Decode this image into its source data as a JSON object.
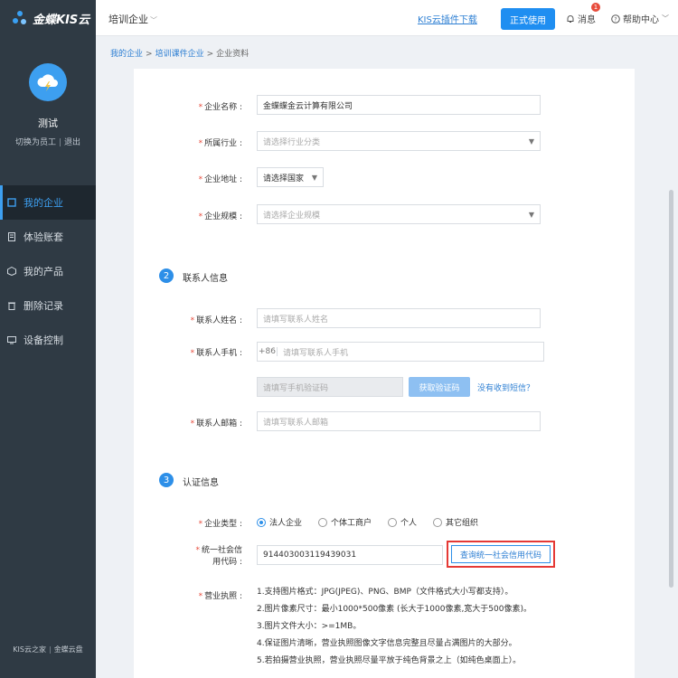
{
  "sidebar": {
    "logo_text": "金蝶KIS云",
    "user_name": "测试",
    "switch_label": "切换为员工",
    "logout_label": "退出",
    "items": [
      {
        "label": "我的企业",
        "icon": "home-icon",
        "active": true
      },
      {
        "label": "体验账套",
        "icon": "ledger-icon"
      },
      {
        "label": "我的产品",
        "icon": "product-icon"
      },
      {
        "label": "删除记录",
        "icon": "trash-icon"
      },
      {
        "label": "设备控制",
        "icon": "device-icon"
      }
    ],
    "footer_left": "KIS云之家",
    "footer_right": "金蝶云盘"
  },
  "topbar": {
    "org_name": "培训企业",
    "plugin_link": "KIS云插件下载",
    "formal_button": "正式使用",
    "messages_label": "消息",
    "messages_count": "1",
    "help_label": "帮助中心"
  },
  "breadcrumb": {
    "item1": "我的企业",
    "item2": "培训课件企业",
    "item3": "企业资料"
  },
  "company": {
    "name_label": "企业名称 :",
    "name_value": "金蝶蝶金云计算有限公司",
    "industry_label": "所属行业 :",
    "industry_placeholder": "请选择行业分类",
    "address_label": "企业地址 :",
    "address_placeholder": "请选择国家",
    "scale_label": "企业规模 :",
    "scale_placeholder": "请选择企业规模"
  },
  "contact": {
    "step": "2",
    "title": "联系人信息",
    "name_label": "联系人姓名 :",
    "name_placeholder": "请填写联系人姓名",
    "phone_label": "联系人手机 :",
    "phone_prefix": "+86",
    "phone_placeholder": "请填写联系人手机",
    "code_placeholder": "请填写手机验证码",
    "get_code_button": "获取验证码",
    "no_sms_link": "没有收到短信？",
    "email_label": "联系人邮箱 :",
    "email_placeholder": "请填写联系人邮箱"
  },
  "certification": {
    "step": "3",
    "title": "认证信息",
    "type_label": "企业类型 :",
    "type_options": [
      "法人企业",
      "个体工商户",
      "个人",
      "其它组织"
    ],
    "type_selected": 0,
    "credit_label_line1": "统一社会信",
    "credit_label_line2": "用代码 :",
    "credit_value": "914403003119439031",
    "query_button": "查询统一社会信用代码",
    "license_label": "营业执照 :",
    "license_rules": [
      "1.支持图片格式：JPG(JPEG)、PNG、BMP（文件格式大小写都支持）。",
      "2.图片像素尺寸：最小1000*500像素 (长大于1000像素,宽大于500像素)。",
      "3.图片文件大小：>=1MB。",
      "4.保证图片清晰，营业执照图像文字信息完整且尽量占满图片的大部分。",
      "5.若拍摄营业执照，营业执照尽量平放于纯色背景之上（如纯色桌面上）。"
    ]
  }
}
